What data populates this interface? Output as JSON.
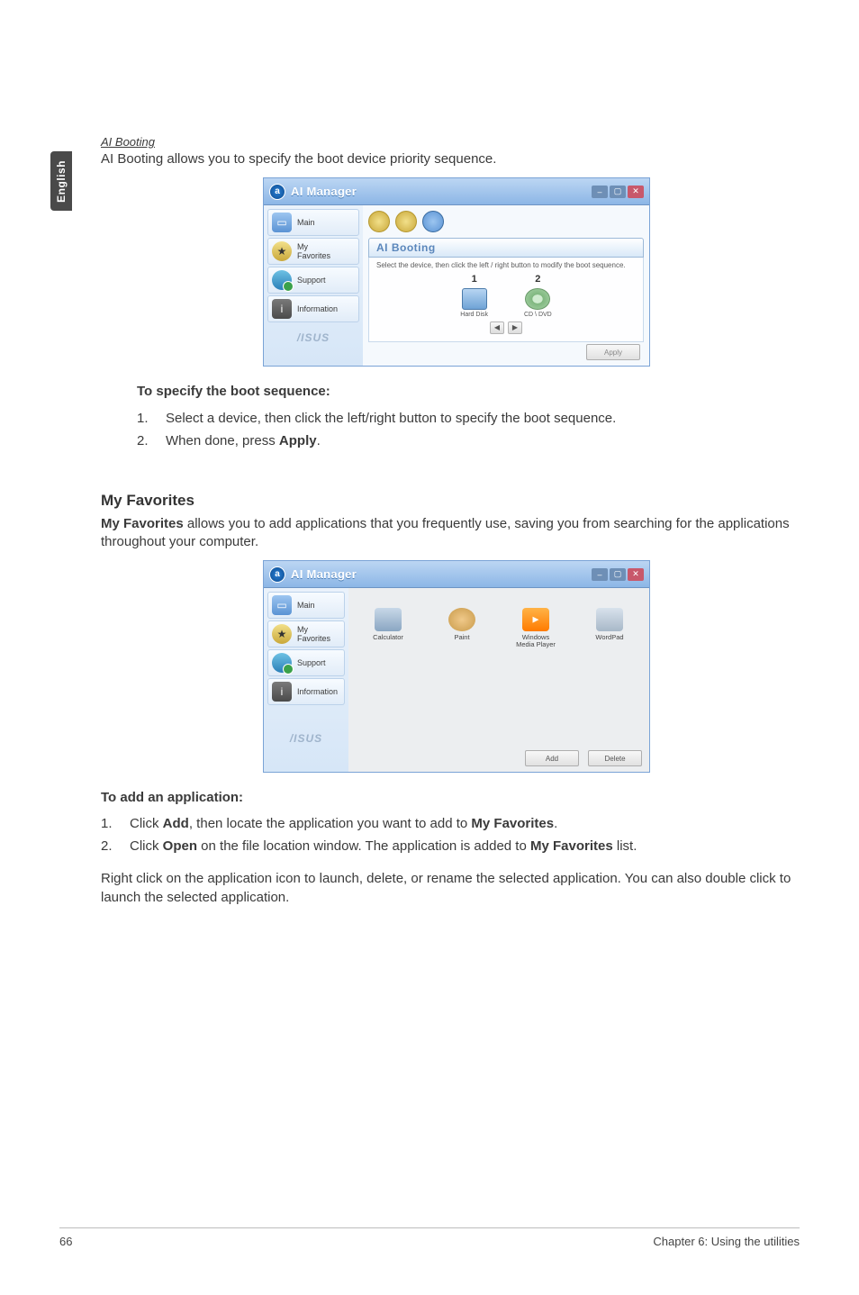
{
  "sideTab": "English",
  "aiBooting": {
    "headingItalic": "AI Booting",
    "intro": "AI Booting allows you to specify the boot device priority sequence.",
    "specHeading": "To specify the boot sequence:",
    "steps": [
      {
        "n": "1.",
        "t": "Select a device, then click the left/right button to specify the boot sequence."
      },
      {
        "n": "2.",
        "t_pre": "When done, press ",
        "t_bold": "Apply",
        "t_post": "."
      }
    ],
    "screenshot": {
      "title": "AI Manager",
      "sidebar": [
        "Main",
        "My\nFavorites",
        "Support",
        "Information"
      ],
      "panelTitle": "AI Booting",
      "hint": "Select the device, then click the left / right button to modify the boot sequence.",
      "items": [
        {
          "num": "1",
          "label": "Hard Disk"
        },
        {
          "num": "2",
          "label": "CD \\ DVD"
        }
      ],
      "applyLabel": "Apply",
      "asus": "/ISUS"
    }
  },
  "myFavorites": {
    "heading": "My Favorites",
    "intro_bold": "My Favorites",
    "intro_rest": " allows you to add applications that you frequently use, saving you from searching for the applications throughout your computer.",
    "addHeading": "To add an application:",
    "steps": [
      {
        "n": "1.",
        "pre": "Click ",
        "b1": "Add",
        "mid": ", then locate the application you want to add to ",
        "b2": "My Favorites",
        "post": "."
      },
      {
        "n": "2.",
        "pre": "Click ",
        "b1": "Open",
        "mid": " on the file location window. The application is added to ",
        "b2": "My Favorites",
        "post": " list."
      }
    ],
    "tail1": "Right click on the application icon to launch, delete, or rename the selected application. You can also double click to launch the selected application.",
    "screenshot": {
      "title": "AI Manager",
      "sidebar": [
        "Main",
        "My\nFavorites",
        "Support",
        "Information"
      ],
      "apps": [
        "Calculator",
        "Paint",
        "Windows\nMedia Player",
        "WordPad"
      ],
      "addLabel": "Add",
      "deleteLabel": "Delete",
      "asus": "/ISUS"
    }
  },
  "footer": {
    "pageNum": "66",
    "chapter": "Chapter 6: Using the utilities"
  }
}
